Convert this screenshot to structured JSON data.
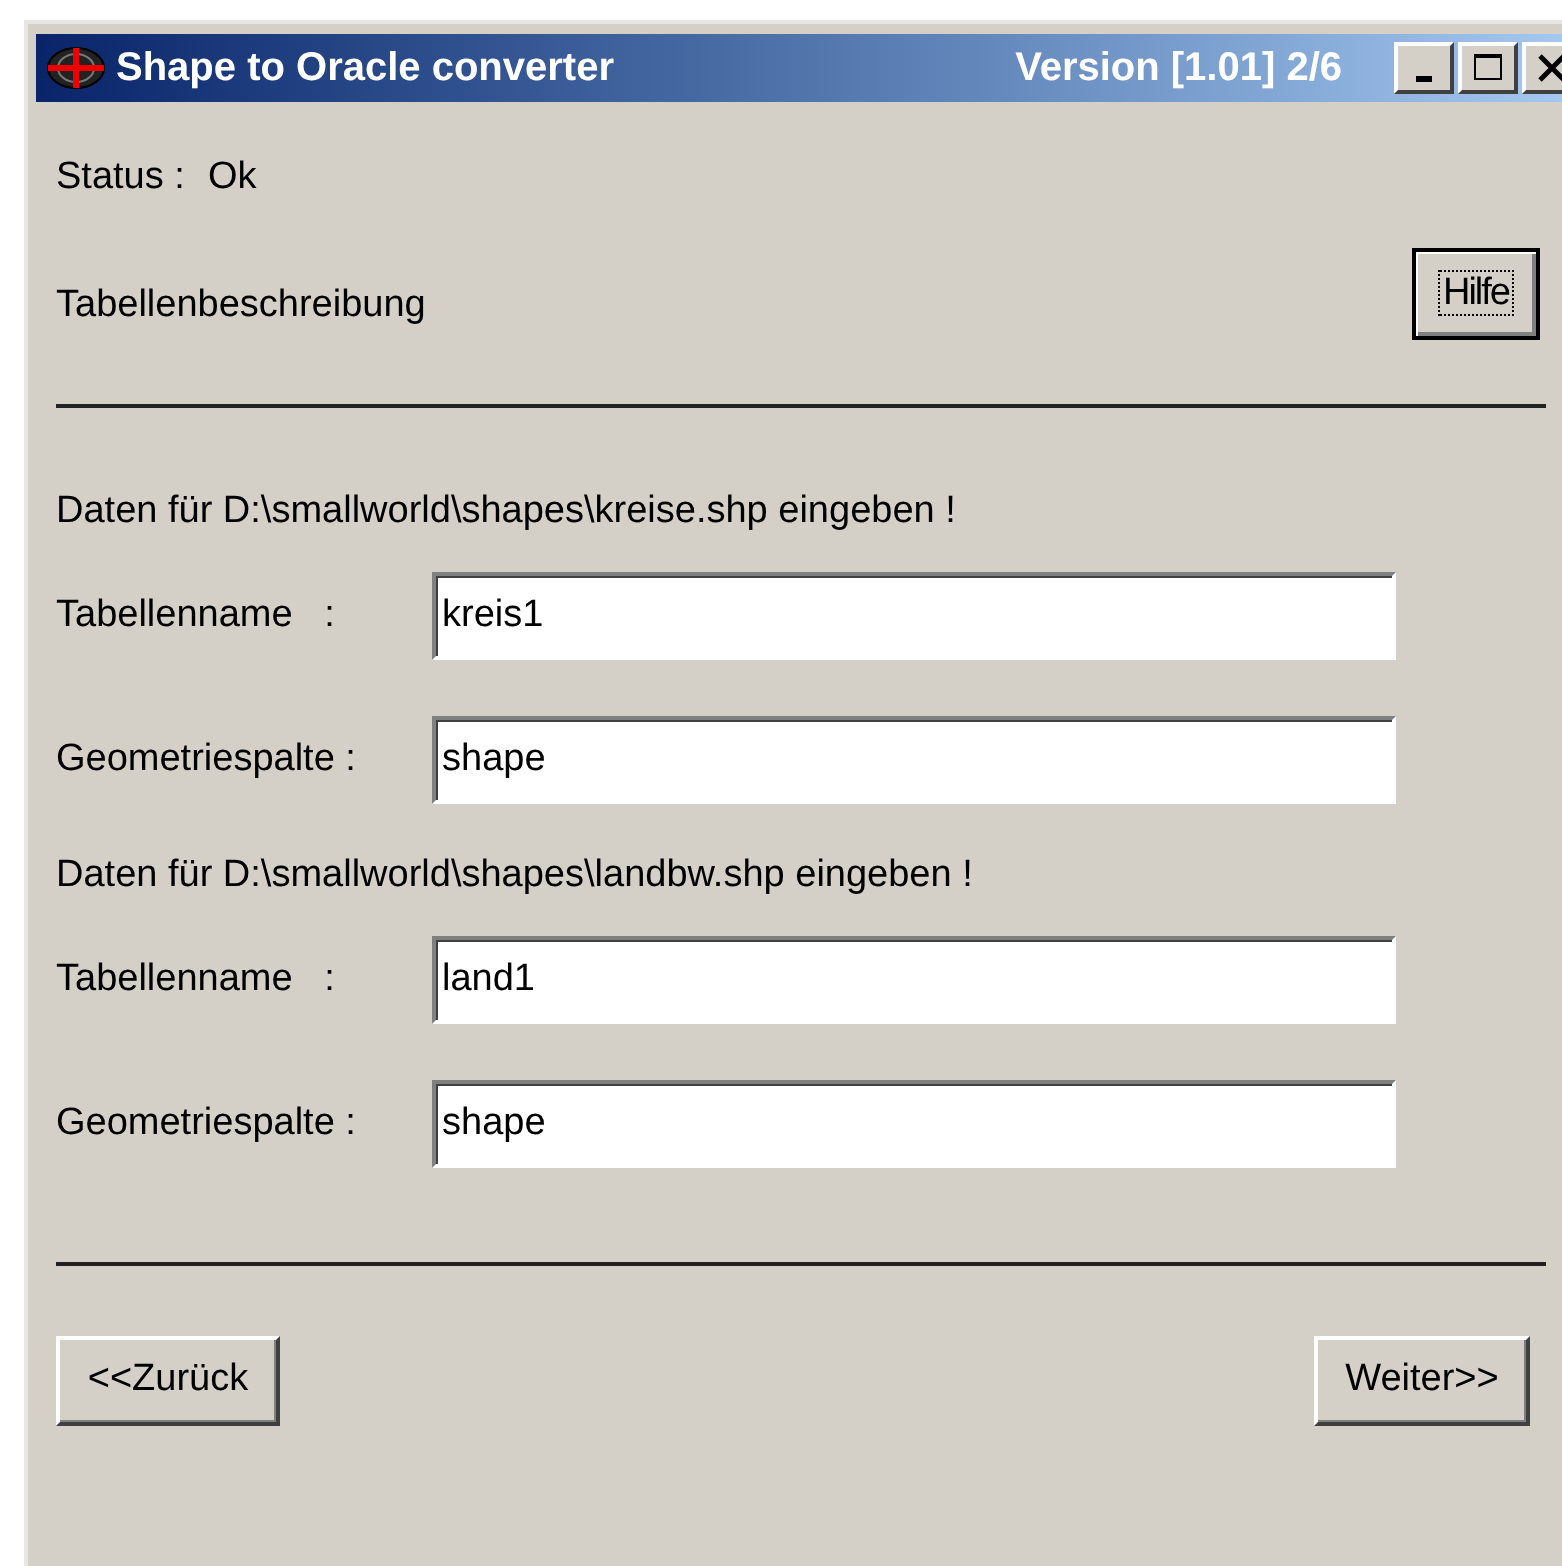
{
  "window": {
    "title": "Shape to Oracle converter",
    "version": "Version [1.01] 2/6"
  },
  "status": {
    "label": "Status :",
    "value": "Ok"
  },
  "heading": "Tabellenbeschreibung",
  "help_button": {
    "label": "Hilfe",
    "focused": true
  },
  "groups": [
    {
      "prompt": "Daten für D:\\smallworld\\shapes\\kreise.shp eingeben !",
      "fields": [
        {
          "label": "Tabellenname   :",
          "value": "kreis1"
        },
        {
          "label": "Geometriespalte :",
          "value": "shape"
        }
      ]
    },
    {
      "prompt": "Daten für D:\\smallworld\\shapes\\landbw.shp eingeben !",
      "fields": [
        {
          "label": "Tabellenname   :",
          "value": "land1"
        },
        {
          "label": "Geometriespalte :",
          "value": "shape"
        }
      ]
    }
  ],
  "buttons": {
    "back": "<<Zurück",
    "next": "Weiter>>"
  }
}
